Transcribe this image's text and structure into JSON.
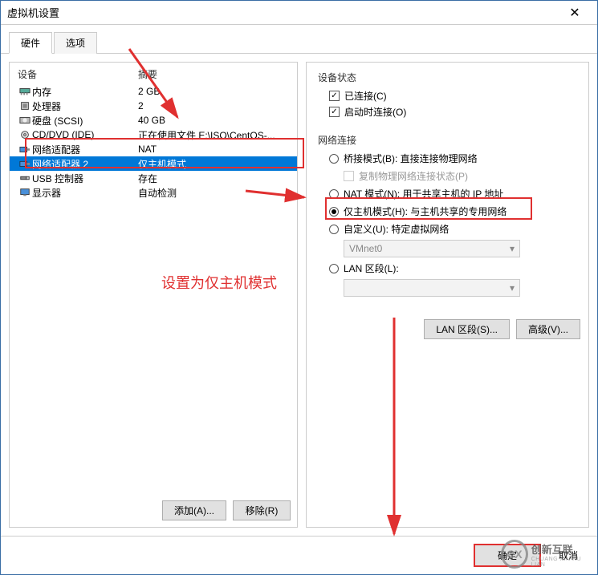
{
  "window": {
    "title": "虚拟机设置"
  },
  "tabs": {
    "hardware": "硬件",
    "options": "选项"
  },
  "leftHeader": {
    "device": "设备",
    "summary": "摘要"
  },
  "devices": [
    {
      "icon": "memory-icon",
      "name": "内存",
      "summary": "2 GB"
    },
    {
      "icon": "cpu-icon",
      "name": "处理器",
      "summary": "2"
    },
    {
      "icon": "disk-icon",
      "name": "硬盘 (SCSI)",
      "summary": "40 GB"
    },
    {
      "icon": "cd-icon",
      "name": "CD/DVD (IDE)",
      "summary": "正在使用文件 E:\\ISO\\CentOS-..."
    },
    {
      "icon": "nic-icon",
      "name": "网络适配器",
      "summary": "NAT"
    },
    {
      "icon": "nic-icon",
      "name": "网络适配器 2",
      "summary": "仅主机模式"
    },
    {
      "icon": "usb-icon",
      "name": "USB 控制器",
      "summary": "存在"
    },
    {
      "icon": "display-icon",
      "name": "显示器",
      "summary": "自动检测"
    }
  ],
  "leftButtons": {
    "add": "添加(A)...",
    "remove": "移除(R)"
  },
  "right": {
    "status": {
      "title": "设备状态",
      "connected": "已连接(C)",
      "connectAtPowerOn": "启动时连接(O)"
    },
    "net": {
      "title": "网络连接",
      "bridge": "桥接模式(B): 直接连接物理网络",
      "replicate": "复制物理网络连接状态(P)",
      "nat": "NAT 模式(N): 用于共享主机的 IP 地址",
      "hostonly": "仅主机模式(H): 与主机共享的专用网络",
      "custom": "自定义(U): 特定虚拟网络",
      "vmnet": "VMnet0",
      "lanSeg": "LAN 区段(L):",
      "lanSegVal": ""
    },
    "buttons": {
      "lanSegments": "LAN 区段(S)...",
      "advanced": "高级(V)..."
    }
  },
  "footer": {
    "ok": "确定",
    "cancel": "取消"
  },
  "annotation": {
    "note": "设置为仅主机模式"
  },
  "watermark": {
    "brand_cn": "创新互联",
    "brand_en": "CHUANG XIN HU LIAN",
    "logo": "CX"
  }
}
